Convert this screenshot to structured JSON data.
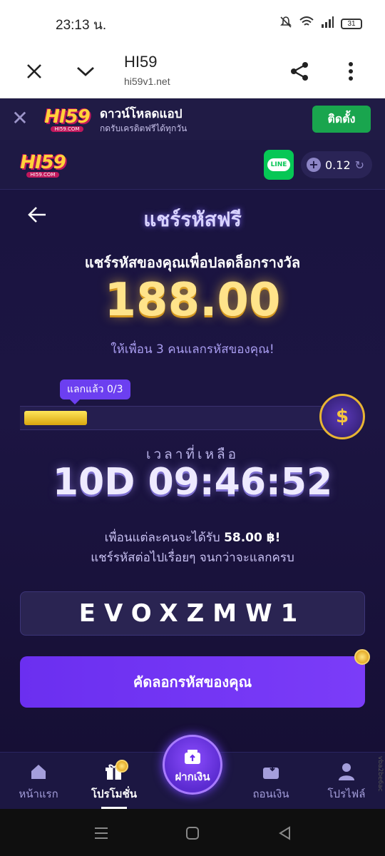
{
  "status_bar": {
    "time": "23:13 น.",
    "battery": "31"
  },
  "browser": {
    "title": "HI59",
    "url": "hi59v1.net"
  },
  "download_banner": {
    "logo_text": "HI59",
    "logo_sub": "HI59.COM",
    "title": "ดาวน์โหลดแอป",
    "subtitle": "กดรับเครดิตฟรีได้ทุกวัน",
    "install_label": "ติดตั้ง"
  },
  "header": {
    "logo_text": "HI59",
    "logo_sub": "HI59.COM",
    "line_label": "LINE",
    "balance": "0.12"
  },
  "page": {
    "title": "แชร์รหัสฟรี",
    "subtitle": "แชร์รหัสของคุณเพื่อปลดล็อกรางวัล",
    "reward": "188.00",
    "invite_text": "ให้เพื่อน 3 คนแลกรหัสของคุณ!",
    "progress_badge": "แลกแล้ว 0/3",
    "progress_fraction": 0.21,
    "remaining_label": "เวลาที่เหลือ",
    "countdown": "10D 09:46:52",
    "info_prefix": "เพื่อนแต่ละคนจะได้รับ ",
    "info_amount": "58.00 ฿!",
    "info_line2": "แชร์รหัสต่อไปเรื่อยๆ จนกว่าจะแลกครบ",
    "code": "EVOXZMW1",
    "copy_label": "คัดลอกรหัสของคุณ"
  },
  "bottom_nav": {
    "home": "หน้าแรก",
    "promo": "โปรโมชั่น",
    "deposit": "ฝากเงิน",
    "withdraw": "ถอนเงิน",
    "profile": "โปรไฟล์"
  },
  "side_text": "vba2be6ac",
  "colors": {
    "accent": "#6c3ff0",
    "install_green": "#19a54e",
    "line_green": "#06c755",
    "gold": "#ffe38a"
  }
}
